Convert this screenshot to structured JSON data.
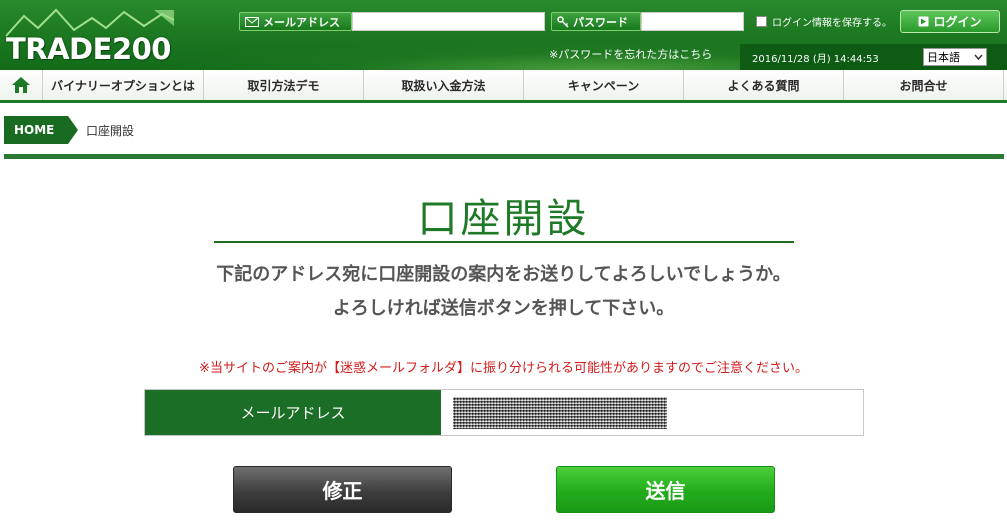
{
  "header": {
    "logo_text": "TRADE200",
    "email_label": "メールアドレス",
    "email_value": "",
    "password_label": "パスワード",
    "password_value": "",
    "remember_label": "ログイン情報を保存する。",
    "login_label": "ログイン",
    "forgot_password": "※パスワードを忘れた方はこちら",
    "datetime": "2016/11/28 (月) 14:44:53",
    "language": "日本語"
  },
  "nav": {
    "items": [
      {
        "label": "バイナリーオプションとは"
      },
      {
        "label": "取引方法デモ"
      },
      {
        "label": "取扱い入金方法"
      },
      {
        "label": "キャンペーン"
      },
      {
        "label": "よくある質問"
      },
      {
        "label": "お問合せ"
      }
    ]
  },
  "breadcrumb": {
    "home": "HOME",
    "current": "口座開設"
  },
  "main": {
    "title": "口座開設",
    "message_line1": "下記のアドレス宛に口座開設の案内をお送りしてよろしいでしょうか。",
    "message_line2": "よろしければ送信ボタンを押して下さい。",
    "notice": "※当サイトのご案内が【迷惑メールフォルダ】に振り分けられる可能性がありますのでご注意ください。",
    "email_label": "メールアドレス",
    "modify_label": "修正",
    "submit_label": "送信"
  },
  "colors": {
    "brand_green": "#1f7a27",
    "notice_red": "#d21b1b",
    "submit_green": "#22ac1d"
  }
}
